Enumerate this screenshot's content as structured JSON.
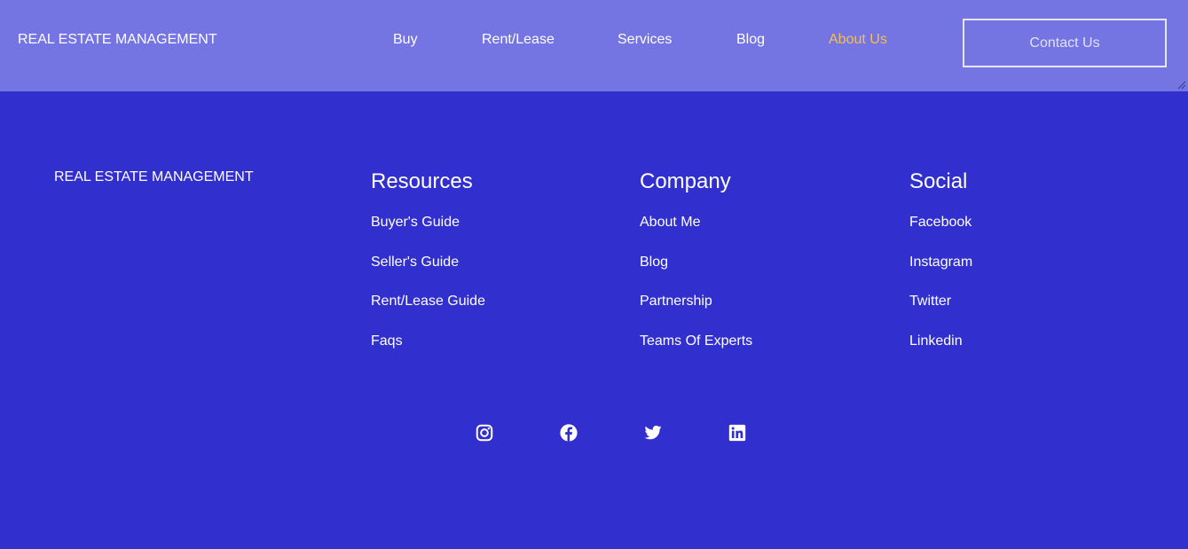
{
  "header": {
    "brand": "REAL ESTATE MANAGEMENT",
    "nav": [
      {
        "label": "Buy",
        "active": false
      },
      {
        "label": "Rent/Lease",
        "active": false
      },
      {
        "label": "Services",
        "active": false
      },
      {
        "label": "Blog",
        "active": false
      },
      {
        "label": "About Us",
        "active": true
      }
    ],
    "contact_label": "Contact Us"
  },
  "footer": {
    "brand": "REAL ESTATE MANAGEMENT",
    "columns": [
      {
        "title": "Resources",
        "links": [
          "Buyer's Guide",
          "Seller's Guide",
          "Rent/Lease Guide",
          "Faqs"
        ]
      },
      {
        "title": "Company",
        "links": [
          "About Me",
          "Blog",
          "Partnership",
          "Teams Of Experts"
        ]
      },
      {
        "title": "Social",
        "links": [
          "Facebook",
          "Instagram",
          "Twitter",
          "Linkedin"
        ]
      }
    ],
    "social_icons": [
      "instagram-icon",
      "facebook-icon",
      "twitter-icon",
      "linkedin-icon"
    ]
  },
  "colors": {
    "nav_background": "#7474e3",
    "page_background": "#312fcd",
    "active_link": "#f4c04e",
    "text": "#ffffff"
  }
}
